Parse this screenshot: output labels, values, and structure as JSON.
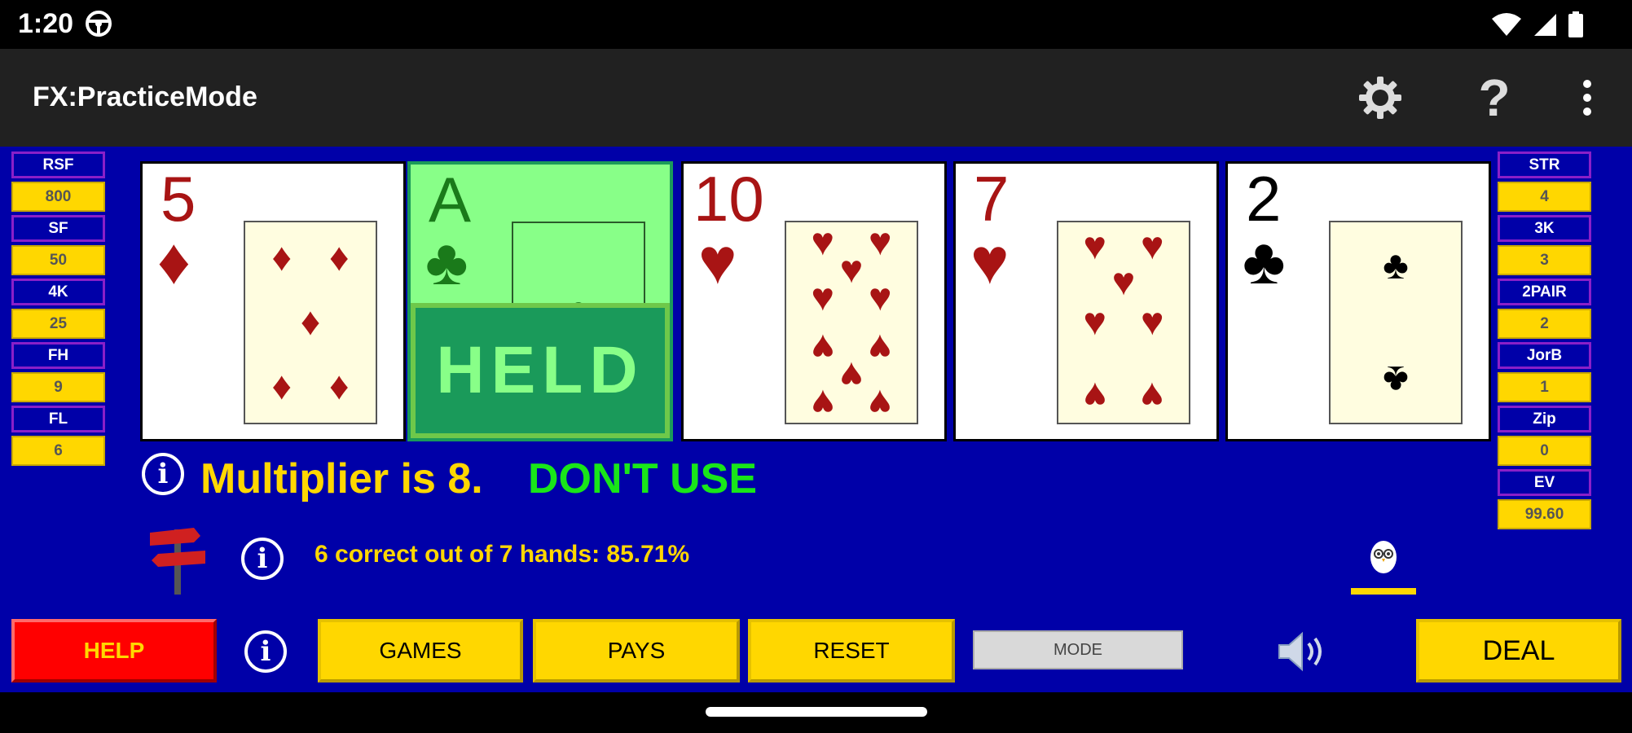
{
  "status_bar": {
    "time": "1:20"
  },
  "app_bar": {
    "title": "FX:PracticeMode"
  },
  "paytable_left": [
    {
      "label": "RSF",
      "value": "800"
    },
    {
      "label": "SF",
      "value": "50"
    },
    {
      "label": "4K",
      "value": "25"
    },
    {
      "label": "FH",
      "value": "9"
    },
    {
      "label": "FL",
      "value": "6"
    }
  ],
  "paytable_right": [
    {
      "label": "STR",
      "value": "4"
    },
    {
      "label": "3K",
      "value": "3"
    },
    {
      "label": "2PAIR",
      "value": "2"
    },
    {
      "label": "JorB",
      "value": "1"
    },
    {
      "label": "Zip",
      "value": "0"
    },
    {
      "label": "EV",
      "value": "99.60"
    }
  ],
  "cards": [
    {
      "rank": "5",
      "suit": "♦",
      "color": "#a81414",
      "held": false
    },
    {
      "rank": "A",
      "suit": "♣",
      "color": "#1a7a1a",
      "held": true
    },
    {
      "rank": "10",
      "suit": "♥",
      "color": "#a81414",
      "held": false
    },
    {
      "rank": "7",
      "suit": "♥",
      "color": "#a81414",
      "held": false
    },
    {
      "rank": "2",
      "suit": "♣",
      "color": "#000000",
      "held": false
    }
  ],
  "held_label": "HELD",
  "multiplier_text": "Multiplier is 8.",
  "dont_use_text": "DON'T USE",
  "score_text": "6 correct out of 7 hands: 85.71%",
  "buttons": {
    "help": "HELP",
    "games": "GAMES",
    "pays": "PAYS",
    "reset": "RESET",
    "mode": "MODE",
    "deal": "DEAL"
  },
  "icons": {
    "info": "info-circle-icon",
    "settings": "gear-icon",
    "help": "question-mark-icon",
    "overflow": "more-vert-icon",
    "sound": "speaker-icon",
    "signpost": "signpost-icon",
    "owl": "owl-icon"
  },
  "colors": {
    "felt": "#0000a8",
    "gold": "#ffd700",
    "held_green": "#1a9a5a",
    "dont_use": "#19e619",
    "help_red": "#ff0000"
  }
}
